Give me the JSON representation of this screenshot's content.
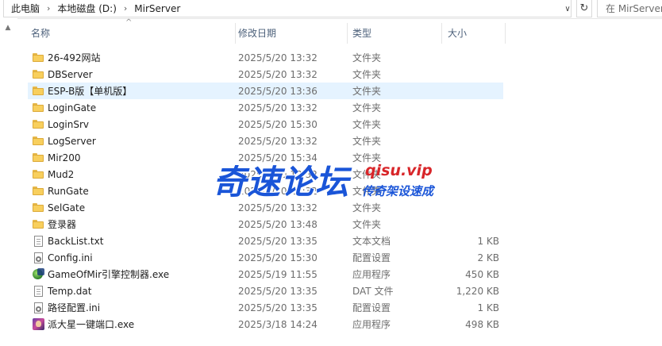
{
  "address": {
    "crumbs": [
      "此电脑",
      "本地磁盘 (D:)",
      "MirServer"
    ],
    "separator": "›",
    "dropdown_glyph": "∨",
    "refresh_glyph": "↻",
    "search_placeholder": "在 MirServer"
  },
  "columns": {
    "name": "名称",
    "date": "修改日期",
    "type": "类型",
    "size": "大小",
    "sort_glyph": "^"
  },
  "nav": {
    "scroll_up_glyph": "▲"
  },
  "files": [
    {
      "icon": "folder-icon",
      "name": "26-492网站",
      "date": "2025/5/20 13:32",
      "type": "文件夹",
      "size": ""
    },
    {
      "icon": "folder-icon",
      "name": "DBServer",
      "date": "2025/5/20 13:32",
      "type": "文件夹",
      "size": ""
    },
    {
      "icon": "folder-icon",
      "name": "ESP-B版【单机版】",
      "date": "2025/5/20 13:36",
      "type": "文件夹",
      "size": ""
    },
    {
      "icon": "folder-icon",
      "name": "LoginGate",
      "date": "2025/5/20 13:32",
      "type": "文件夹",
      "size": ""
    },
    {
      "icon": "folder-icon",
      "name": "LoginSrv",
      "date": "2025/5/20 15:30",
      "type": "文件夹",
      "size": ""
    },
    {
      "icon": "folder-icon",
      "name": "LogServer",
      "date": "2025/5/20 13:32",
      "type": "文件夹",
      "size": ""
    },
    {
      "icon": "folder-icon",
      "name": "Mir200",
      "date": "2025/5/20 15:34",
      "type": "文件夹",
      "size": ""
    },
    {
      "icon": "folder-icon",
      "name": "Mud2",
      "date": "2025/5/20 13:32",
      "type": "文件夹",
      "size": ""
    },
    {
      "icon": "folder-icon",
      "name": "RunGate",
      "date": "2025/5/20 13:32",
      "type": "文件夹",
      "size": ""
    },
    {
      "icon": "folder-icon",
      "name": "SelGate",
      "date": "2025/5/20 13:32",
      "type": "文件夹",
      "size": ""
    },
    {
      "icon": "folder-icon",
      "name": "登录器",
      "date": "2025/5/20 13:48",
      "type": "文件夹",
      "size": ""
    },
    {
      "icon": "text-file-icon",
      "name": "BackList.txt",
      "date": "2025/5/20 13:35",
      "type": "文本文档",
      "size": "1 KB"
    },
    {
      "icon": "config-file-icon",
      "name": "Config.ini",
      "date": "2025/5/20 15:30",
      "type": "配置设置",
      "size": "2 KB"
    },
    {
      "icon": "game-exe-icon",
      "name": "GameOfMir引擎控制器.exe",
      "date": "2025/5/19 11:55",
      "type": "应用程序",
      "size": "450 KB"
    },
    {
      "icon": "text-file-icon",
      "name": "Temp.dat",
      "date": "2025/5/20 13:35",
      "type": "DAT 文件",
      "size": "1,220 KB"
    },
    {
      "icon": "config-file-icon",
      "name": "路径配置.ini",
      "date": "2025/5/20 13:35",
      "type": "配置设置",
      "size": "1 KB"
    },
    {
      "icon": "pai-exe-icon",
      "name": "派大星一键端口.exe",
      "date": "2025/3/18 14:24",
      "type": "应用程序",
      "size": "498 KB"
    }
  ],
  "hovered_row": 2,
  "watermark": {
    "brand": "奇速论坛",
    "url": "qisu.vip",
    "tagline": "传奇架设速成"
  },
  "colors": {
    "hover": "#e5f3ff",
    "folder": "#f8cf5d",
    "header_text": "#4c607a",
    "watermark_blue": "#1a55d8",
    "watermark_red": "#d8262a"
  }
}
